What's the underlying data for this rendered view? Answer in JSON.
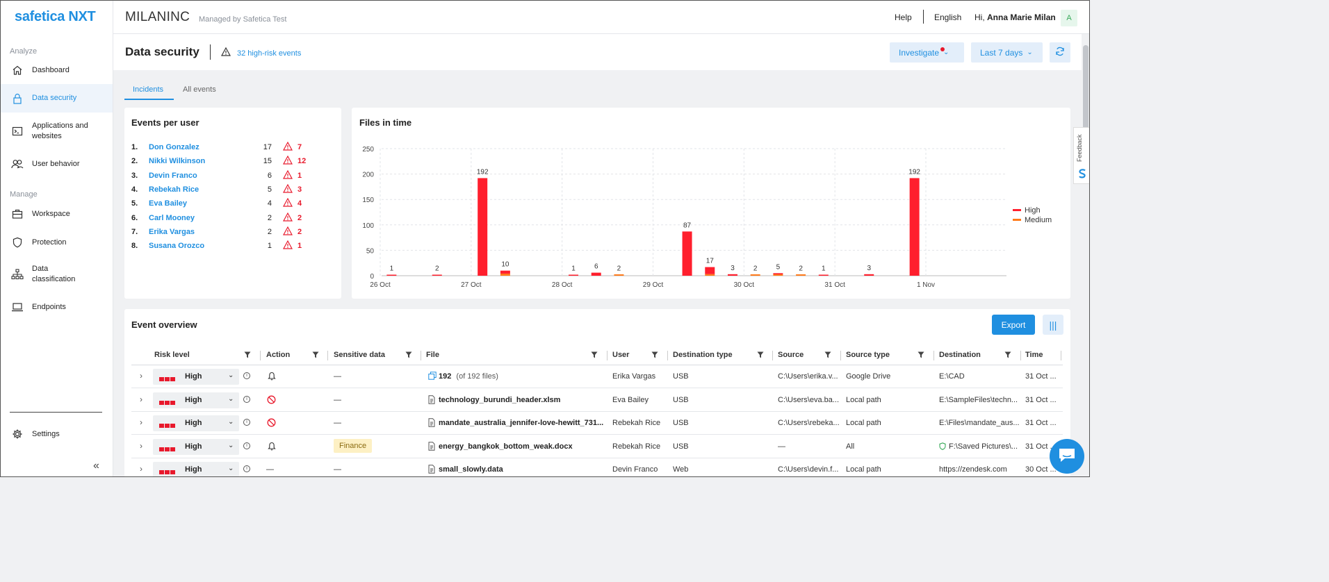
{
  "app": {
    "logo_text": "safetica NXT"
  },
  "sidebar": {
    "sections": {
      "analyze": "Analyze",
      "manage": "Manage"
    },
    "items": [
      {
        "label": "Dashboard",
        "icon": "home-icon"
      },
      {
        "label": "Data security",
        "icon": "lock-icon"
      },
      {
        "label": "Applications and websites",
        "icon": "terminal-icon"
      },
      {
        "label": "User behavior",
        "icon": "users-icon"
      },
      {
        "label": "Workspace",
        "icon": "briefcase-icon"
      },
      {
        "label": "Protection",
        "icon": "shield-icon"
      },
      {
        "label": "Data classification",
        "icon": "hierarchy-icon"
      },
      {
        "label": "Endpoints",
        "icon": "laptop-icon"
      },
      {
        "label": "Settings",
        "icon": "gear-icon"
      }
    ],
    "collapse_glyph": "«"
  },
  "topbar": {
    "company": "MILANINC",
    "managed_by": "Managed by Safetica Test",
    "help": "Help",
    "language": "English",
    "greeting": "Hi,",
    "user_name": "Anna Marie Milan",
    "avatar_initial": "A"
  },
  "page": {
    "title": "Data security",
    "high_risk_events": "32 high-risk events",
    "investigate": "Investigate",
    "period": "Last 7 days"
  },
  "tabs": [
    {
      "label": "Incidents",
      "active": true
    },
    {
      "label": "All events",
      "active": false
    }
  ],
  "events_per_user": {
    "title": "Events per user",
    "rows": [
      {
        "rank": "1.",
        "name": "Don Gonzalez",
        "count": "17",
        "high": "7"
      },
      {
        "rank": "2.",
        "name": "Nikki Wilkinson",
        "count": "15",
        "high": "12"
      },
      {
        "rank": "3.",
        "name": "Devin Franco",
        "count": "6",
        "high": "1"
      },
      {
        "rank": "4.",
        "name": "Rebekah Rice",
        "count": "5",
        "high": "3"
      },
      {
        "rank": "5.",
        "name": "Eva Bailey",
        "count": "4",
        "high": "4"
      },
      {
        "rank": "6.",
        "name": "Carl Mooney",
        "count": "2",
        "high": "2"
      },
      {
        "rank": "7.",
        "name": "Erika Vargas",
        "count": "2",
        "high": "2"
      },
      {
        "rank": "8.",
        "name": "Susana Orozco",
        "count": "1",
        "high": "1"
      }
    ]
  },
  "chart_data": {
    "type": "bar",
    "title": "Files in time",
    "ylim": [
      0,
      250
    ],
    "yticks": [
      0,
      50,
      100,
      150,
      200,
      250
    ],
    "xticks": [
      "26 Oct",
      "27 Oct",
      "28 Oct",
      "29 Oct",
      "30 Oct",
      "31 Oct",
      "1 Nov"
    ],
    "x_start": "26 Oct 00:00",
    "bar_step_hours": 6,
    "legend": {
      "position": "right",
      "items": [
        {
          "name": "High",
          "color": "#ff1f2d"
        },
        {
          "name": "Medium",
          "color": "#ff7a1a"
        }
      ]
    },
    "bars": [
      {
        "slot": 0,
        "total": 1,
        "high": 1,
        "medium": 0
      },
      {
        "slot": 2,
        "total": 2,
        "high": 2,
        "medium": 0
      },
      {
        "slot": 4,
        "total": 192,
        "high": 192,
        "medium": 0
      },
      {
        "slot": 5,
        "total": 10,
        "high": 6,
        "medium": 4
      },
      {
        "slot": 8,
        "total": 1,
        "high": 1,
        "medium": 0
      },
      {
        "slot": 9,
        "total": 6,
        "high": 6,
        "medium": 0
      },
      {
        "slot": 10,
        "total": 2,
        "high": 0,
        "medium": 2
      },
      {
        "slot": 13,
        "total": 87,
        "high": 87,
        "medium": 0
      },
      {
        "slot": 14,
        "total": 17,
        "high": 14,
        "medium": 3
      },
      {
        "slot": 15,
        "total": 3,
        "high": 3,
        "medium": 0
      },
      {
        "slot": 16,
        "total": 2,
        "high": 0,
        "medium": 2
      },
      {
        "slot": 17,
        "total": 5,
        "high": 3,
        "medium": 2
      },
      {
        "slot": 18,
        "total": 2,
        "high": 0,
        "medium": 2
      },
      {
        "slot": 19,
        "total": 1,
        "high": 1,
        "medium": 0
      },
      {
        "slot": 21,
        "total": 3,
        "high": 3,
        "medium": 0
      },
      {
        "slot": 23,
        "total": 192,
        "high": 192,
        "medium": 0
      }
    ]
  },
  "event_overview": {
    "title": "Event overview",
    "export": "Export",
    "columns": [
      "Risk level",
      "Action",
      "Sensitive data",
      "File",
      "User",
      "Destination type",
      "Source",
      "Source type",
      "Destination",
      "Time"
    ],
    "rows": [
      {
        "risk": "High",
        "action": "bell-icon",
        "sensitive": "—",
        "file": "192",
        "file_extra": "(of 192 files)",
        "file_icon": "copy-icon",
        "user": "Erika Vargas",
        "dest_type": "USB",
        "source": "C:\\Users\\erika.v...",
        "source_type": "Google Drive",
        "destination": "E:\\CAD",
        "time": "31 Oct ..."
      },
      {
        "risk": "High",
        "action": "block-icon",
        "sensitive": "—",
        "file": "technology_burundi_header.xlsm",
        "file_extra": "",
        "file_icon": "file-icon",
        "user": "Eva Bailey",
        "dest_type": "USB",
        "source": "C:\\Users\\eva.ba...",
        "source_type": "Local path",
        "destination": "E:\\SampleFiles\\techn...",
        "time": "31 Oct ..."
      },
      {
        "risk": "High",
        "action": "block-icon",
        "sensitive": "—",
        "file": "mandate_australia_jennifer-love-hewitt_731...",
        "file_extra": "",
        "file_icon": "file-icon",
        "user": "Rebekah Rice",
        "dest_type": "USB",
        "source": "C:\\Users\\rebeka...",
        "source_type": "Local path",
        "destination": "E:\\Files\\mandate_aus...",
        "time": "31 Oct ..."
      },
      {
        "risk": "High",
        "action": "bell-icon",
        "sensitive": "Finance",
        "file": "energy_bangkok_bottom_weak.docx",
        "file_extra": "",
        "file_icon": "file-icon",
        "user": "Rebekah Rice",
        "dest_type": "USB",
        "source": "—",
        "source_type": "All",
        "destination": "F:\\Saved Pictures\\...",
        "time": "31 Oct ..."
      },
      {
        "risk": "High",
        "action": "—",
        "sensitive": "—",
        "file": "small_slowly.data",
        "file_extra": "",
        "file_icon": "file-icon",
        "user": "Devin Franco",
        "dest_type": "Web",
        "source": "C:\\Users\\devin.f...",
        "source_type": "Local path",
        "destination": "https://zendesk.com",
        "time": "30 Oct ..."
      }
    ]
  },
  "feedback": "Feedback",
  "colors": {
    "accent": "#1f8fe0",
    "high": "#ff1f2d",
    "medium": "#ff7a1a"
  }
}
